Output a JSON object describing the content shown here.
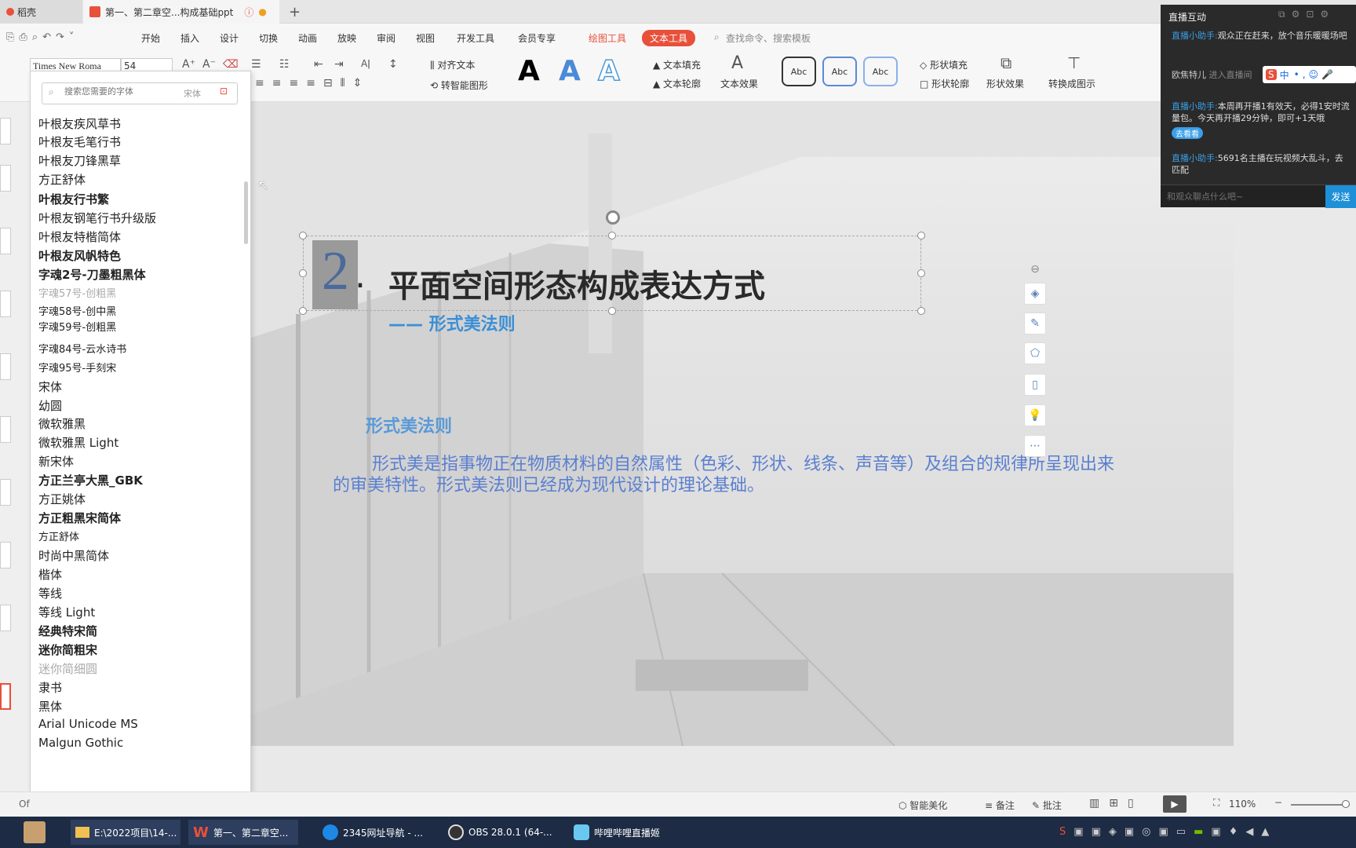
{
  "tabs": {
    "home": "稻壳",
    "doc": "第一、第二章空...构成基础ppt",
    "new_tab": "+"
  },
  "menu": {
    "items": [
      "开始",
      "插入",
      "设计",
      "切换",
      "动画",
      "放映",
      "审阅",
      "视图",
      "开发工具",
      "会员专享"
    ],
    "drawing_tools": "绘图工具",
    "text_tools": "文本工具",
    "search": "查找命令、搜索模板"
  },
  "ribbon": {
    "font_name": "Times New Roma",
    "font_size": "54",
    "align_text": "对齐文本",
    "smart_shape": "转智能图形",
    "text_fill": "文本填充",
    "text_outline": "文本轮廓",
    "text_effect": "文本效果",
    "abc": "Abc",
    "shape_fill": "形状填充",
    "shape_outline": "形状轮廓",
    "shape_effect": "形状效果",
    "convert_to_graphic": "转换成图示",
    "big_a": "A"
  },
  "font_panel": {
    "search_placeholder": "搜索您需要的字体",
    "current_font": "宋体",
    "fonts": [
      "叶根友疾风草书",
      "叶根友毛笔行书",
      "叶根友刀锋黑草",
      "方正舒体",
      "叶根友行书繁",
      "叶根友钢笔行书升级版",
      "叶根友特楷简体",
      "叶根友风帆特色",
      "字魂2号-刀墨粗黑体",
      "字魂57号-创粗黑",
      "字魂58号-创中黑",
      "字魂59号-创粗黑",
      "字魂84号-云水诗书",
      "字魂95号-手刻宋",
      "宋体",
      "幼圆",
      "微软雅黑",
      "微软雅黑 Light",
      "新宋体",
      "方正兰亭大黑_GBK",
      "方正姚体",
      "方正粗黑宋简体",
      "方正舒体",
      "时尚中黑简体",
      "楷体",
      "等线",
      "等线 Light",
      "经典特宋简",
      "迷你简粗宋",
      "迷你简细圆",
      "隶书",
      "黑体",
      "Arial Unicode MS",
      "Malgun Gothic"
    ]
  },
  "slide": {
    "number": "2",
    "dot": ".",
    "title": "平面空间形态构成表达方式",
    "subtitle": "—— 形式美法则",
    "section_heading": "形式美法则",
    "body": "形式美是指事物正在物质材料的自然属性（色彩、形状、线条、声音等）及组合的规律所呈现出来的审美特性。形式美法则已经成为现代设计的理论基础。"
  },
  "live_panel": {
    "title": "直播互动",
    "messages": [
      {
        "name": "直播小助手:",
        "text": "观众正在赶来，放个音乐暖暖场吧"
      },
      {
        "name": "欧焦特儿",
        "text": "进入直播间"
      },
      {
        "name": "直播小助手:",
        "text": "本周再开播1有效天，必得1安时流量包。今天再开播29分钟，即可+1天哦"
      },
      {
        "name": "直播小助手:",
        "text": "5691名主播在玩视频大乱斗，去匹配"
      }
    ],
    "go_label": "去看看",
    "input_placeholder": "和观众聊点什么吧~",
    "send": "发送",
    "ime": "中"
  },
  "status": {
    "left": "Of",
    "smart_beautify": "智能美化",
    "notes": "备注",
    "comment": "批注",
    "zoom": "110%"
  },
  "taskbar": {
    "items": [
      "E:\\2022项目\\14-...",
      "第一、第二章空...",
      "2345网址导航 - ...",
      "OBS 28.0.1 (64-...",
      "哔哩哔哩直播姬"
    ]
  },
  "colors": {
    "accent_red": "#e8503a",
    "title_dark": "#2a2a2a",
    "subtitle_blue": "#3a8fd6",
    "body_blue": "#5a7fd0"
  }
}
